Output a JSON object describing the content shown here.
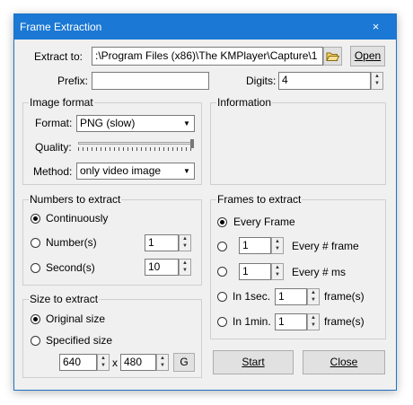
{
  "window": {
    "title": "Frame Extraction",
    "close_glyph": "×"
  },
  "extract": {
    "label": "Extract to:",
    "path": ":\\Program Files (x86)\\The KMPlayer\\Capture\\1",
    "open_label": "Open",
    "folder_icon": "folder-icon"
  },
  "prefix": {
    "label": "Prefix:",
    "value": ""
  },
  "digits": {
    "label": "Digits:",
    "value": "4"
  },
  "image_format": {
    "title": "Image format",
    "format_label": "Format:",
    "format_value": "PNG (slow)",
    "quality_label": "Quality:",
    "method_label": "Method:",
    "method_value": "only video image"
  },
  "information": {
    "title": "Information"
  },
  "numbers": {
    "title": "Numbers to extract",
    "continuously": "Continuously",
    "numbers_label": "Number(s)",
    "numbers_value": "1",
    "seconds_label": "Second(s)",
    "seconds_value": "10",
    "selected": "continuously"
  },
  "size": {
    "title": "Size to extract",
    "original": "Original size",
    "specified": "Specified size",
    "width": "640",
    "x_sep": "x",
    "height": "480",
    "g_label": "G",
    "selected": "original"
  },
  "frames": {
    "title": "Frames to extract",
    "every_frame": "Every Frame",
    "every_n_frame_value": "1",
    "every_n_frame_label": "Every # frame",
    "every_n_ms_value": "1",
    "every_n_ms_label": "Every # ms",
    "in_1sec_label": "In 1sec.",
    "in_1sec_value": "1",
    "in_1sec_unit": "frame(s)",
    "in_1min_label": "In 1min.",
    "in_1min_value": "1",
    "in_1min_unit": "frame(s)",
    "selected": "every_frame"
  },
  "actions": {
    "start_label": "Start",
    "close_label": "Close"
  }
}
